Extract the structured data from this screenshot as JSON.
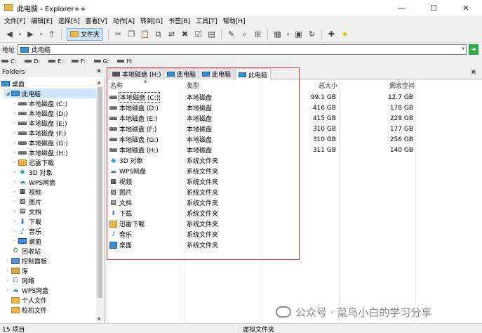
{
  "window": {
    "title": "此电脑 - Explorer++",
    "min": "—",
    "max": "☐",
    "close": "✕"
  },
  "menu": [
    "文件[F]",
    "编辑[E]",
    "选择[S]",
    "查看[V]",
    "动作[A]",
    "转到[G]",
    "书签[B]",
    "工具[T]",
    "帮助[H]"
  ],
  "toolbar": {
    "folders_label": "文件夹"
  },
  "address": {
    "label": "地址",
    "value": "此电脑"
  },
  "drives_bar": [
    "C:",
    "D:",
    "E:",
    "F:",
    "G:",
    "H:"
  ],
  "folders_pane": {
    "title": "Folders",
    "items": [
      {
        "label": "桌面",
        "icon": "desktop-icon",
        "level": 0,
        "expanded": true
      },
      {
        "label": "此电脑",
        "icon": "computer-icon",
        "level": 1,
        "expanded": true,
        "selected": true
      },
      {
        "label": "本地磁盘 (C:)",
        "icon": "drive-icon",
        "level": 2
      },
      {
        "label": "本地磁盘 (D:)",
        "icon": "drive-icon",
        "level": 2
      },
      {
        "label": "本地磁盘 (E:)",
        "icon": "drive-icon",
        "level": 2
      },
      {
        "label": "本地磁盘 (F:)",
        "icon": "drive-icon",
        "level": 2
      },
      {
        "label": "本地磁盘 (G:)",
        "icon": "drive-icon",
        "level": 2
      },
      {
        "label": "本地磁盘 (H:)",
        "icon": "drive-icon",
        "level": 2
      },
      {
        "label": "迅雷下载",
        "icon": "folder-icon",
        "level": 2
      },
      {
        "label": "3D 对象",
        "icon": "cube-icon",
        "level": 2
      },
      {
        "label": "WPS网盘",
        "icon": "cloud-icon",
        "level": 2
      },
      {
        "label": "视频",
        "icon": "video-icon",
        "level": 2
      },
      {
        "label": "图片",
        "icon": "picture-icon",
        "level": 2
      },
      {
        "label": "文档",
        "icon": "document-icon",
        "level": 2
      },
      {
        "label": "下载",
        "icon": "download-icon",
        "level": 2
      },
      {
        "label": "音乐",
        "icon": "music-icon",
        "level": 2
      },
      {
        "label": "桌面",
        "icon": "desktop-icon",
        "level": 2
      },
      {
        "label": "回收站",
        "icon": "recycle-bin-icon",
        "level": 1
      },
      {
        "label": "控制面板",
        "icon": "control-panel-icon",
        "level": 1
      },
      {
        "label": "库",
        "icon": "library-icon",
        "level": 1
      },
      {
        "label": "网络",
        "icon": "network-icon",
        "level": 1
      },
      {
        "label": "WPS网盘",
        "icon": "cloud-icon",
        "level": 1
      },
      {
        "label": "个人文件",
        "icon": "folder-icon",
        "level": 1
      },
      {
        "label": "校机文件",
        "icon": "folder-icon",
        "level": 1
      }
    ]
  },
  "tabs": [
    {
      "label": "本地磁盘 (H:)",
      "active": false
    },
    {
      "label": "此电脑",
      "active": false
    },
    {
      "label": "此电脑",
      "active": false
    },
    {
      "label": "此电脑",
      "active": true
    }
  ],
  "columns": {
    "name": "名称",
    "type": "类型",
    "total": "总大小",
    "free": "剩余空间"
  },
  "rows": [
    {
      "name": "本地磁盘 (C:)",
      "type": "本地磁盘",
      "total": "99.1 GB",
      "free": "12.7 GB",
      "icon": "drive-icon"
    },
    {
      "name": "本地磁盘 (D:)",
      "type": "本地磁盘",
      "total": "416 GB",
      "free": "178 GB",
      "icon": "drive-icon"
    },
    {
      "name": "本地磁盘 (E:)",
      "type": "本地磁盘",
      "total": "415 GB",
      "free": "228 GB",
      "icon": "drive-icon"
    },
    {
      "name": "本地磁盘 (F:)",
      "type": "本地磁盘",
      "total": "310 GB",
      "free": "177 GB",
      "icon": "drive-icon"
    },
    {
      "name": "本地磁盘 (G:)",
      "type": "本地磁盘",
      "total": "310 GB",
      "free": "256 GB",
      "icon": "drive-icon"
    },
    {
      "name": "本地磁盘 (H:)",
      "type": "本地磁盘",
      "total": "311 GB",
      "free": "140 GB",
      "icon": "drive-icon"
    },
    {
      "name": "3D 对象",
      "type": "系统文件夹",
      "total": "",
      "free": "",
      "icon": "cube-icon"
    },
    {
      "name": "WPS网盘",
      "type": "系统文件夹",
      "total": "",
      "free": "",
      "icon": "cloud-icon"
    },
    {
      "name": "视频",
      "type": "系统文件夹",
      "total": "",
      "free": "",
      "icon": "video-icon"
    },
    {
      "name": "图片",
      "type": "系统文件夹",
      "total": "",
      "free": "",
      "icon": "picture-icon"
    },
    {
      "name": "文档",
      "type": "系统文件夹",
      "total": "",
      "free": "",
      "icon": "document-icon"
    },
    {
      "name": "下载",
      "type": "系统文件夹",
      "total": "",
      "free": "",
      "icon": "download-icon"
    },
    {
      "name": "迅雷下载",
      "type": "系统文件夹",
      "total": "",
      "free": "",
      "icon": "folder-icon"
    },
    {
      "name": "音乐",
      "type": "系统文件夹",
      "total": "",
      "free": "",
      "icon": "music-icon"
    },
    {
      "name": "桌面",
      "type": "系统文件夹",
      "total": "",
      "free": "",
      "icon": "desktop-icon"
    }
  ],
  "status": {
    "count": "15 项目",
    "location": "虚拟文件夹"
  },
  "watermark": "公众号 · 菜鸟小白的学习分享",
  "colors": {
    "selection": "#cce8ff",
    "highlight_box": "#e0303a",
    "accent": "#3a8fd6"
  }
}
